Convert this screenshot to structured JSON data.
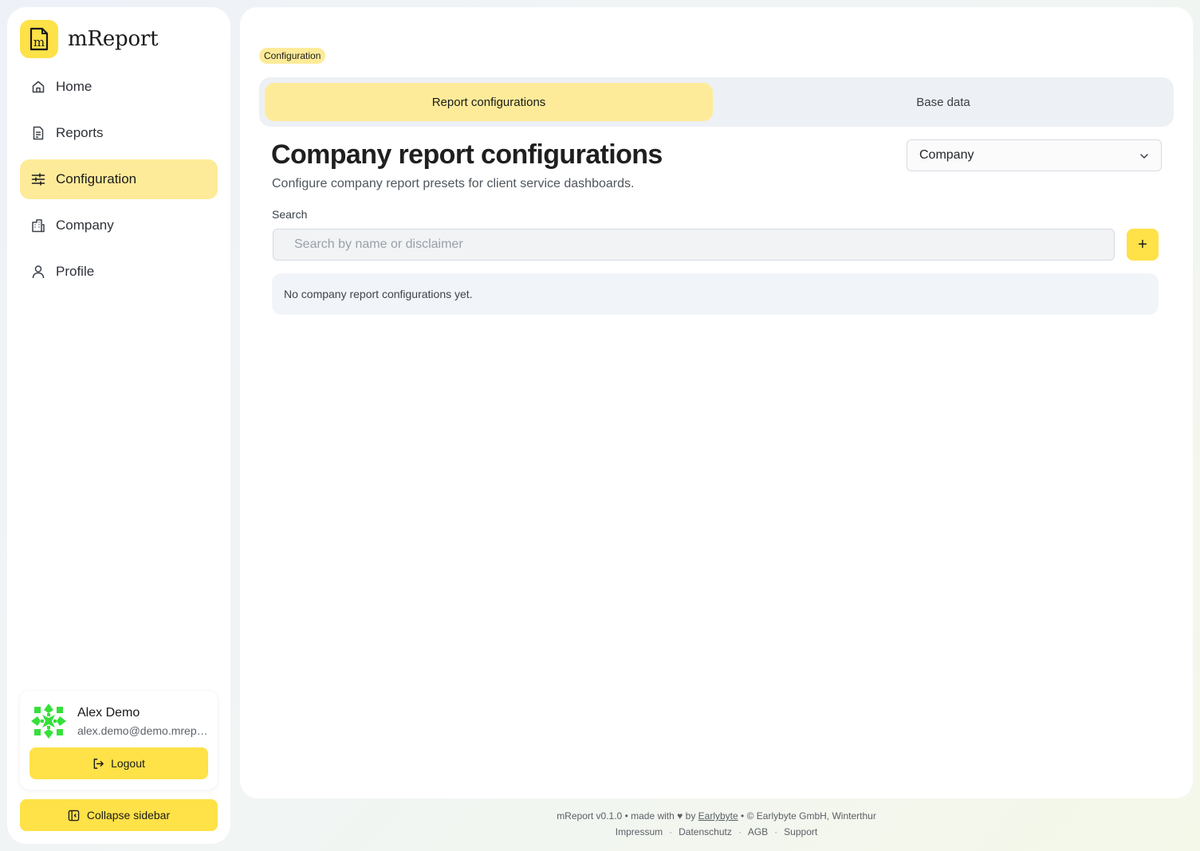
{
  "app": {
    "name": "mReport"
  },
  "sidebar": {
    "items": [
      {
        "label": "Home",
        "icon": "home-icon"
      },
      {
        "label": "Reports",
        "icon": "document-icon"
      },
      {
        "label": "Configuration",
        "icon": "sliders-icon",
        "active": true
      },
      {
        "label": "Company",
        "icon": "building-icon"
      },
      {
        "label": "Profile",
        "icon": "user-icon"
      }
    ],
    "user": {
      "name": "Alex Demo",
      "email": "alex.demo@demo.mreport.ch"
    },
    "logout_label": "Logout",
    "collapse_label": "Collapse sidebar"
  },
  "main": {
    "breadcrumb": "Configuration",
    "tabs": [
      {
        "label": "Report configurations",
        "active": true
      },
      {
        "label": "Base data",
        "active": false
      }
    ],
    "title": "Company report configurations",
    "subtitle": "Configure company report presets for client service dashboards.",
    "scope_select": {
      "selected": "Company"
    },
    "search": {
      "label": "Search",
      "placeholder": "Search by name or disclaimer",
      "value": ""
    },
    "add_label": "+",
    "empty_message": "No company report configurations yet."
  },
  "footer": {
    "version": "mReport v0.1.0",
    "made_with": "made with",
    "by": "by",
    "company_link": "Earlybyte",
    "copyright": "© Earlybyte GmbH, Winterthur",
    "links": [
      "Impressum",
      "Datenschutz",
      "AGB",
      "Support"
    ]
  },
  "colors": {
    "accent": "#ffe148",
    "accent_soft": "#feeb99",
    "surface": "#ffffff",
    "muted_bg": "#edf0f4"
  }
}
